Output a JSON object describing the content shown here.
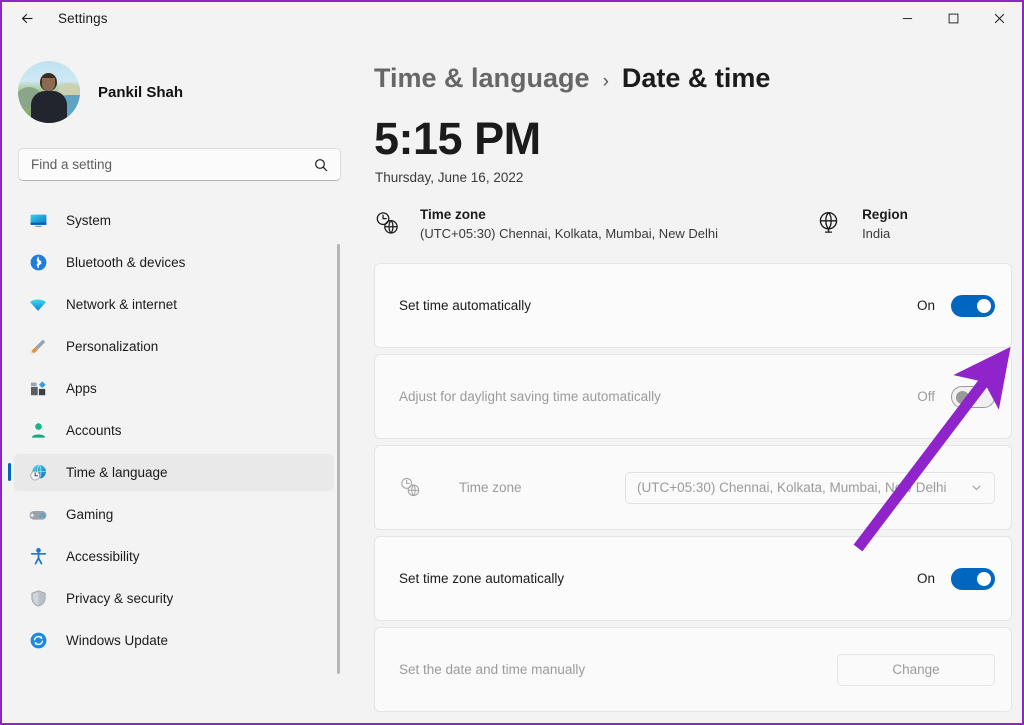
{
  "titlebar": {
    "back_icon": "back-arrow-icon",
    "title": "Settings",
    "minimize": "–",
    "maximize": "☐",
    "close": "✕"
  },
  "sidebar": {
    "profile": {
      "name": "Pankil Shah",
      "avatar_icon": "user-avatar-photo"
    },
    "search": {
      "placeholder": "Find a setting",
      "value": "",
      "icon": "search-icon"
    },
    "items": [
      {
        "label": "System",
        "icon": "monitor-icon",
        "active": false
      },
      {
        "label": "Bluetooth & devices",
        "icon": "bluetooth-icon",
        "active": false
      },
      {
        "label": "Network & internet",
        "icon": "wifi-icon",
        "active": false
      },
      {
        "label": "Personalization",
        "icon": "paintbrush-icon",
        "active": false
      },
      {
        "label": "Apps",
        "icon": "apps-icon",
        "active": false
      },
      {
        "label": "Accounts",
        "icon": "person-icon",
        "active": false
      },
      {
        "label": "Time & language",
        "icon": "clock-globe-icon",
        "active": true
      },
      {
        "label": "Gaming",
        "icon": "gamepad-icon",
        "active": false
      },
      {
        "label": "Accessibility",
        "icon": "accessibility-icon",
        "active": false
      },
      {
        "label": "Privacy & security",
        "icon": "shield-icon",
        "active": false
      },
      {
        "label": "Windows Update",
        "icon": "update-refresh-icon",
        "active": false
      }
    ]
  },
  "main": {
    "breadcrumb": {
      "parent": "Time & language",
      "separator": "›",
      "current": "Date & time"
    },
    "clock": {
      "time": "5:15 PM",
      "date": "Thursday, June 16, 2022"
    },
    "info": [
      {
        "icon": "clock-globe-icon",
        "title": "Time zone",
        "value": "(UTC+05:30) Chennai, Kolkata, Mumbai, New Delhi"
      },
      {
        "icon": "globe-stand-icon",
        "title": "Region",
        "value": "India"
      }
    ],
    "settings": [
      {
        "label": "Set time automatically",
        "state_text": "On",
        "toggle": "on",
        "disabled": false,
        "control": "toggle"
      },
      {
        "label": "Adjust for daylight saving time automatically",
        "state_text": "Off",
        "toggle": "off",
        "disabled": true,
        "control": "toggle"
      },
      {
        "label": "Time zone",
        "icon": "clock-globe-icon",
        "dropdown_value": "(UTC+05:30) Chennai, Kolkata, Mumbai, New Delhi",
        "disabled": true,
        "control": "dropdown"
      },
      {
        "label": "Set time zone automatically",
        "state_text": "On",
        "toggle": "on",
        "disabled": false,
        "control": "toggle"
      },
      {
        "label": "Set the date and time manually",
        "button_label": "Change",
        "disabled": true,
        "control": "button"
      }
    ]
  },
  "colors": {
    "accent": "#0067c0",
    "annotation": "#8e24c9",
    "window_bg": "#f3f3f3",
    "card_bg": "#fbfbfb"
  },
  "annotation": {
    "type": "arrow",
    "color": "#8e24c9",
    "points_to": "set-time-automatically-toggle"
  }
}
